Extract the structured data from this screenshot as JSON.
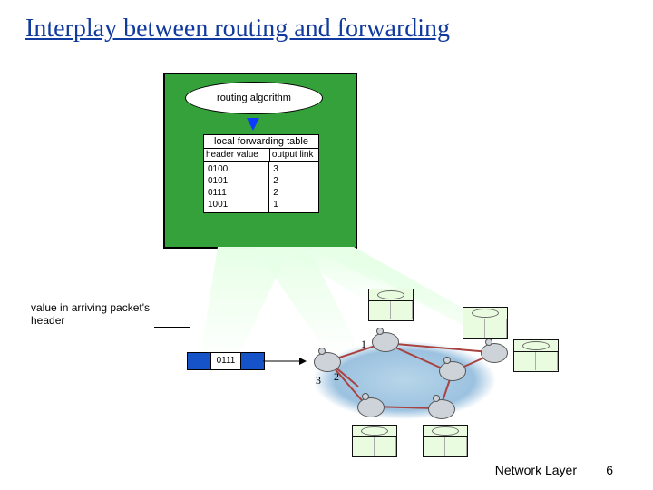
{
  "title": "Interplay between routing and forwarding",
  "router_box": {
    "algorithm_label": "routing algorithm",
    "forwarding_table": {
      "title": "local forwarding table",
      "header_left": "header value",
      "header_right": "output link",
      "rows": [
        {
          "hv": "0100",
          "out": "3"
        },
        {
          "hv": "0101",
          "out": "2"
        },
        {
          "hv": "0111",
          "out": "2"
        },
        {
          "hv": "1001",
          "out": "1"
        }
      ]
    }
  },
  "arriving_label": "value in arriving packet's header",
  "packet_header_value": "0111",
  "ports": {
    "p1": "1",
    "p2": "2",
    "p3": "3"
  },
  "footer": {
    "text": "Network Layer",
    "page": "6"
  }
}
